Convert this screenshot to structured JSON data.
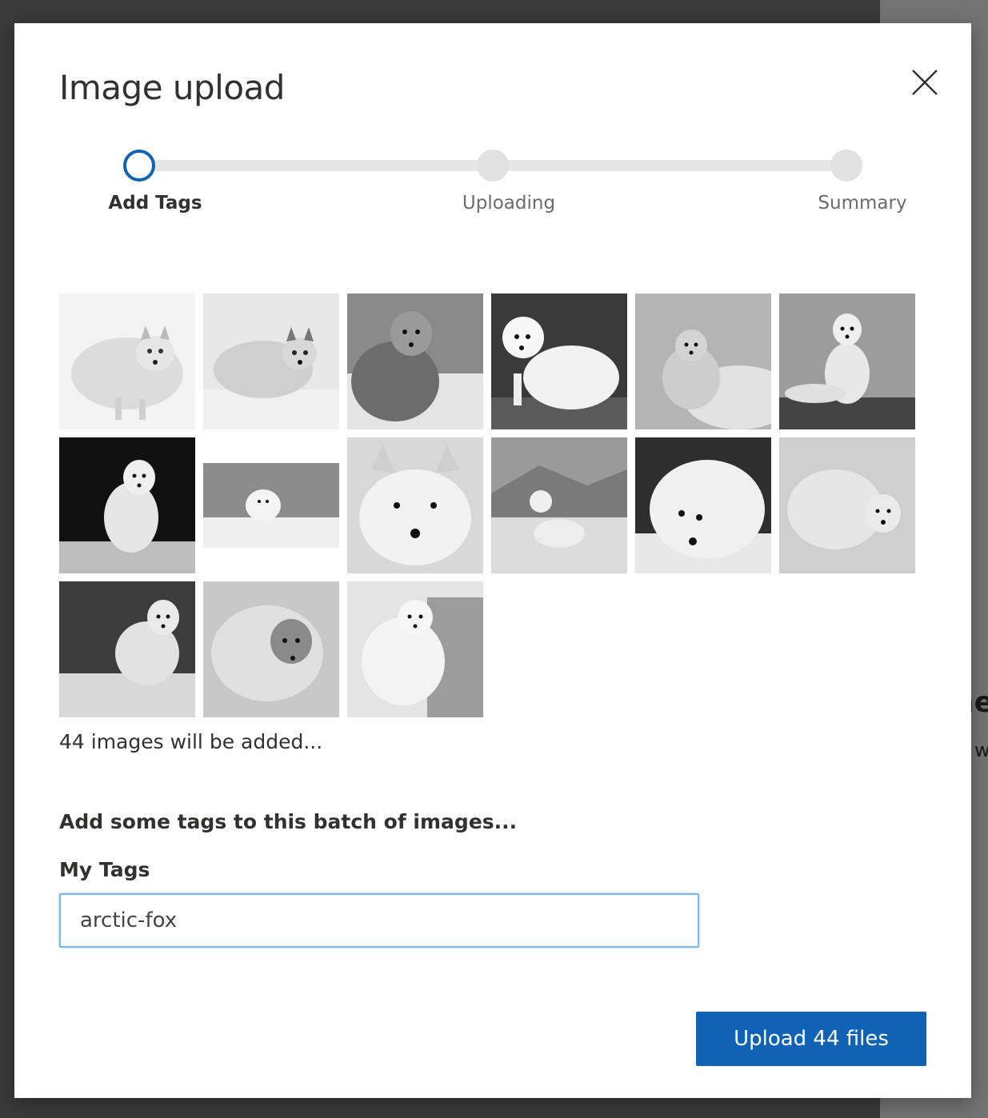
{
  "background": {
    "fragment_heading": "ne",
    "fragment_text": "w"
  },
  "dialog": {
    "title": "Image upload",
    "close_icon": "close-icon"
  },
  "stepper": {
    "steps": [
      {
        "label": "Add Tags",
        "state": "active"
      },
      {
        "label": "Uploading",
        "state": "pending"
      },
      {
        "label": "Summary",
        "state": "pending"
      }
    ],
    "accent_color": "#0f62b4"
  },
  "thumbnails": {
    "items": [
      {
        "name": "arctic-fox-01"
      },
      {
        "name": "arctic-fox-02"
      },
      {
        "name": "arctic-fox-03"
      },
      {
        "name": "arctic-fox-04"
      },
      {
        "name": "arctic-fox-05"
      },
      {
        "name": "arctic-fox-06"
      },
      {
        "name": "arctic-fox-07"
      },
      {
        "name": "arctic-fox-08"
      },
      {
        "name": "arctic-fox-09"
      },
      {
        "name": "arctic-fox-10"
      },
      {
        "name": "arctic-fox-11"
      },
      {
        "name": "arctic-fox-12"
      },
      {
        "name": "arctic-fox-13"
      },
      {
        "name": "arctic-fox-14"
      },
      {
        "name": "arctic-fox-15"
      }
    ],
    "count_text": "44 images will be added..."
  },
  "tags": {
    "heading": "Add some tags to this batch of images...",
    "field_label": "My Tags",
    "value": "arctic-fox"
  },
  "actions": {
    "upload_label": "Upload 44 files",
    "upload_color": "#0f62b4"
  }
}
